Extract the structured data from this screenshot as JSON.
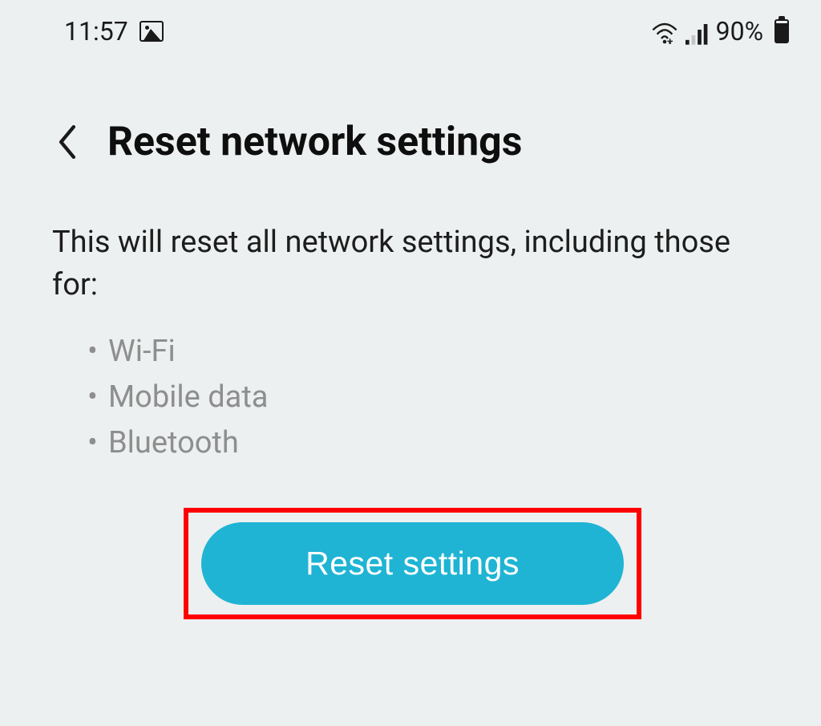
{
  "status": {
    "time": "11:57",
    "battery_text": "90%"
  },
  "header": {
    "title": "Reset network settings"
  },
  "content": {
    "description": "This will reset all network settings, including those for:",
    "bullets": {
      "0": "Wi-Fi",
      "1": "Mobile data",
      "2": "Bluetooth"
    }
  },
  "button": {
    "label": "Reset settings"
  },
  "colors": {
    "accent": "#1fb4d4",
    "highlight_border": "#ff0000"
  }
}
